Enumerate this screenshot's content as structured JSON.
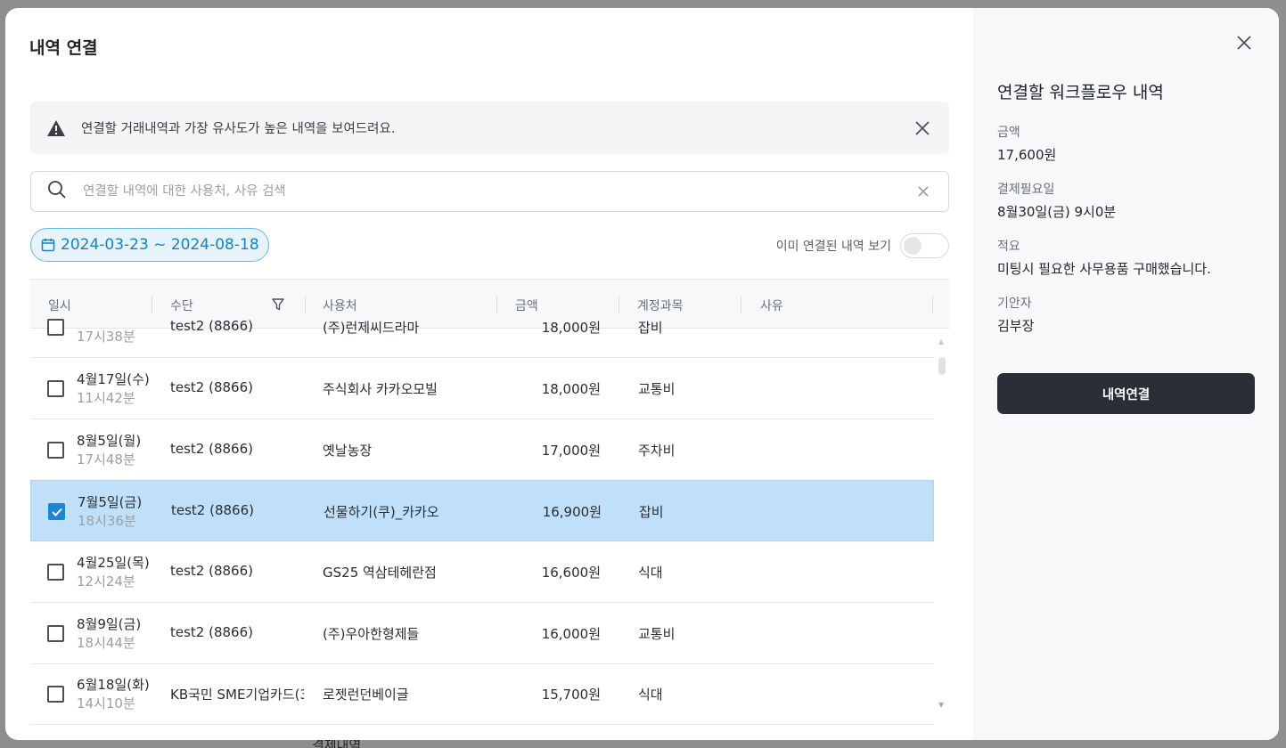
{
  "modal": {
    "title": "내역 연결",
    "notice": "연결할 거래내역과 가장 유사도가 높은 내역을 보여드려요.",
    "search_placeholder": "연결할 내역에 대한 사용처, 사유 검색",
    "date_range": "2024-03-23 ~ 2024-08-18",
    "toggle_label": "이미 연결된 내역 보기",
    "toggle_on": false
  },
  "table": {
    "headers": [
      "일시",
      "수단",
      "사용처",
      "금액",
      "계정과목",
      "사유"
    ],
    "partial_row": {
      "date": "",
      "time": "17시38분",
      "method": "test2 (8866)",
      "merchant": "(주)런제씨드라마",
      "amount": "18,000원",
      "account": "잡비"
    },
    "rows": [
      {
        "date": "4월17일(수)",
        "time": "11시42분",
        "method": "test2 (8866)",
        "merchant": "주식회사 카카오모빌",
        "amount": "18,000원",
        "account": "교통비",
        "checked": false
      },
      {
        "date": "8월5일(월)",
        "time": "17시48분",
        "method": "test2 (8866)",
        "merchant": "옛날농장",
        "amount": "17,000원",
        "account": "주차비",
        "checked": false
      },
      {
        "date": "7월5일(금)",
        "time": "18시36분",
        "method": "test2 (8866)",
        "merchant": "선물하기(쿠)_카카오",
        "amount": "16,900원",
        "account": "잡비",
        "checked": true
      },
      {
        "date": "4월25일(목)",
        "time": "12시24분",
        "method": "test2 (8866)",
        "merchant": "GS25 역삼테헤란점",
        "amount": "16,600원",
        "account": "식대",
        "checked": false
      },
      {
        "date": "8월9일(금)",
        "time": "18시44분",
        "method": "test2 (8866)",
        "merchant": "(주)우아한형제들",
        "amount": "16,000원",
        "account": "교통비",
        "checked": false
      },
      {
        "date": "6월18일(화)",
        "time": "14시10분",
        "method": "KB국민 SME기업카드(3",
        "merchant": "로젯런던베이글",
        "amount": "15,700원",
        "account": "식대",
        "checked": false
      }
    ]
  },
  "panel": {
    "title": "연결할 워크플로우 내역",
    "amount_label": "금액",
    "amount_value": "17,600원",
    "due_label": "결제필요일",
    "due_value": "8월30일(금) 9시0분",
    "memo_label": "적요",
    "memo_value": "미팅시 필요한 사무용품 구매했습니다.",
    "drafter_label": "기안자",
    "drafter_value": "김부장",
    "button_label": "내역연결"
  },
  "backdrop_text": "결제내역",
  "colors": {
    "accent": "#1e84d4",
    "selected_row": "#bfe0f8",
    "button": "#2a2f37"
  }
}
